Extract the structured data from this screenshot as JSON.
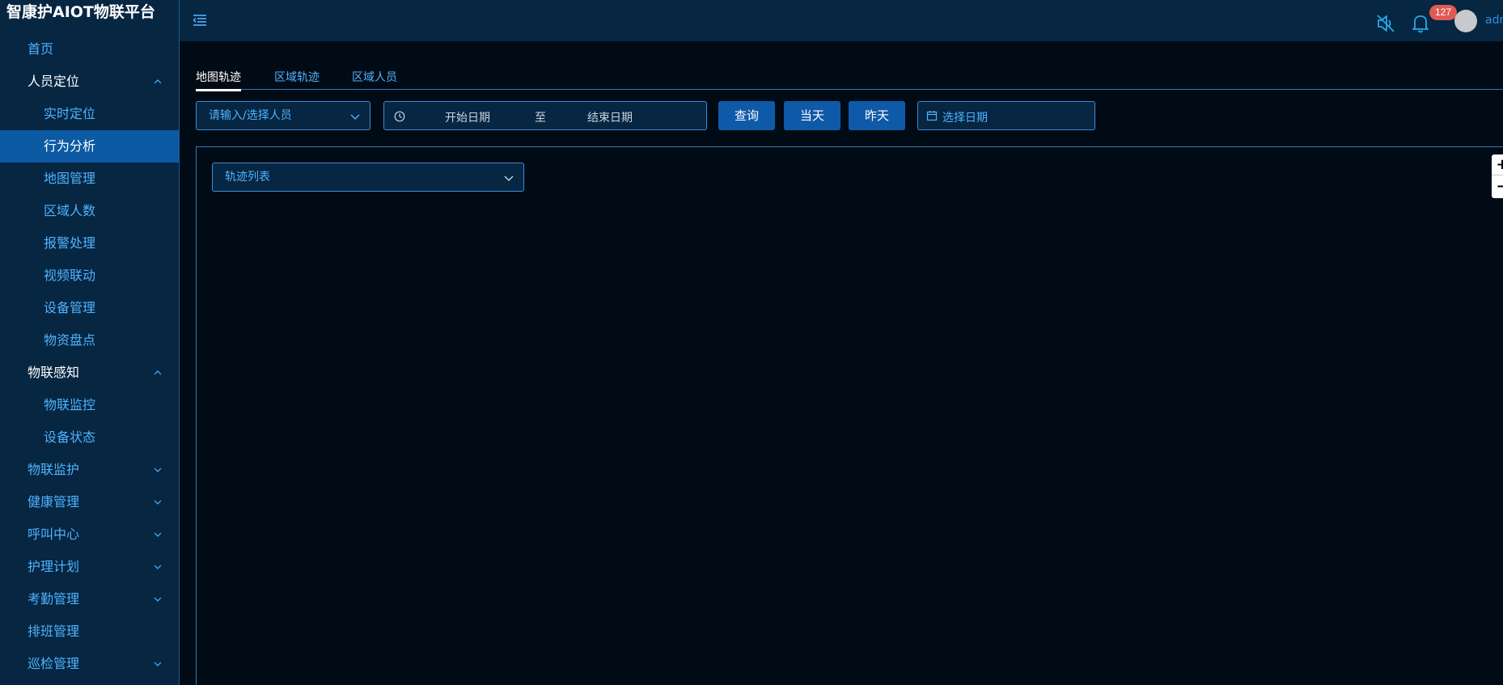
{
  "app": {
    "title": "智康护AIOT物联平台"
  },
  "colors": {
    "sidebar_bg": "#062642",
    "main_bg": "#010b15",
    "accent": "#4fb3ff",
    "active_item_bg": "#0b5aa3",
    "button_bg": "#0f5aa8",
    "badge": "#e05a55"
  },
  "sidebar": {
    "items": [
      {
        "label": "首页",
        "level": 1,
        "state": "normal"
      },
      {
        "label": "人员定位",
        "level": 1,
        "state": "expanded",
        "icon": "chevron-up-icon"
      },
      {
        "label": "实时定位",
        "level": 2,
        "state": "normal"
      },
      {
        "label": "行为分析",
        "level": 2,
        "state": "active"
      },
      {
        "label": "地图管理",
        "level": 2,
        "state": "normal"
      },
      {
        "label": "区域人数",
        "level": 2,
        "state": "normal"
      },
      {
        "label": "报警处理",
        "level": 2,
        "state": "normal"
      },
      {
        "label": "视频联动",
        "level": 2,
        "state": "normal"
      },
      {
        "label": "设备管理",
        "level": 2,
        "state": "normal"
      },
      {
        "label": "物资盘点",
        "level": 2,
        "state": "normal"
      },
      {
        "label": "物联感知",
        "level": 1,
        "state": "expanded",
        "icon": "chevron-up-icon"
      },
      {
        "label": "物联监控",
        "level": 2,
        "state": "normal"
      },
      {
        "label": "设备状态",
        "level": 2,
        "state": "normal"
      },
      {
        "label": "物联监护",
        "level": 1,
        "state": "collapsed",
        "icon": "chevron-down-icon"
      },
      {
        "label": "健康管理",
        "level": 1,
        "state": "collapsed",
        "icon": "chevron-down-icon"
      },
      {
        "label": "呼叫中心",
        "level": 1,
        "state": "collapsed",
        "icon": "chevron-down-icon"
      },
      {
        "label": "护理计划",
        "level": 1,
        "state": "collapsed",
        "icon": "chevron-down-icon"
      },
      {
        "label": "考勤管理",
        "level": 1,
        "state": "collapsed",
        "icon": "chevron-down-icon"
      },
      {
        "label": "排班管理",
        "level": 1,
        "state": "normal"
      },
      {
        "label": "巡检管理",
        "level": 1,
        "state": "collapsed",
        "icon": "chevron-down-icon"
      }
    ]
  },
  "header": {
    "icons": [
      "menu-collapse-icon",
      "sound-muted-icon",
      "bell-icon"
    ],
    "notification_count": "127",
    "username": "adm"
  },
  "main": {
    "tabs": [
      {
        "label": "地图轨迹",
        "active": true
      },
      {
        "label": "区域轨迹",
        "active": false
      },
      {
        "label": "区域人员",
        "active": false
      }
    ],
    "filters": {
      "person_placeholder": "请输入/选择人员",
      "start_date_placeholder": "开始日期",
      "range_separator": "至",
      "end_date_placeholder": "结束日期",
      "query_label": "查询",
      "today_label": "当天",
      "yesterday_label": "昨天",
      "date_picker_placeholder": "选择日期"
    },
    "map": {
      "track_list_label": "轨迹列表",
      "zoom_in_label": "+",
      "zoom_out_label": "−"
    }
  }
}
